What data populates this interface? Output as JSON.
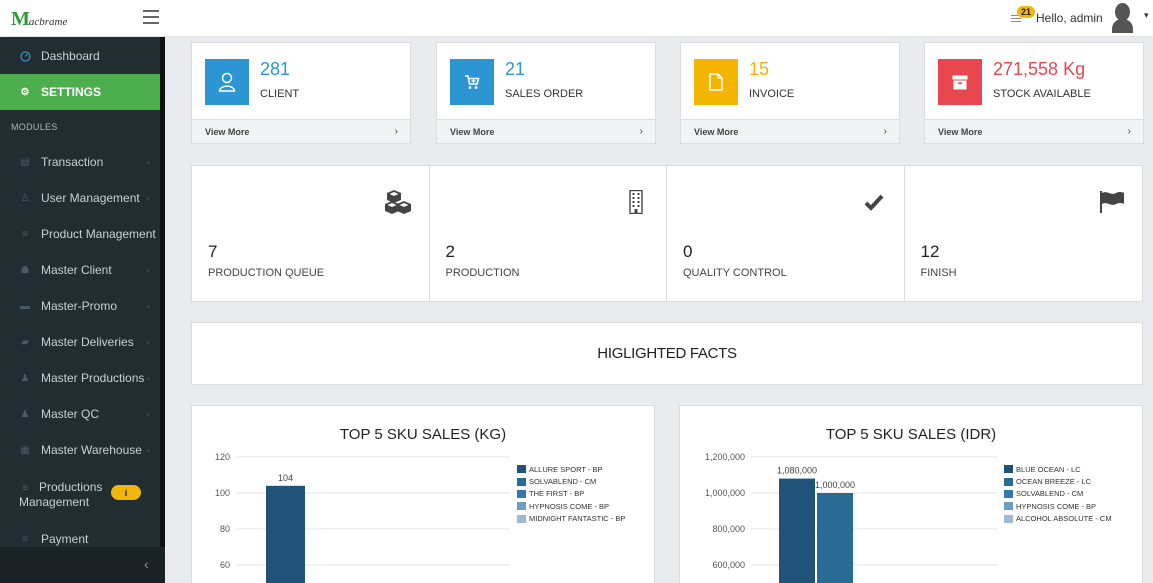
{
  "topbar": {
    "logo_mark": "M",
    "logo_text": "acbrame",
    "notification_count": "21",
    "greeting": "Hello, admin",
    "caret": "▾"
  },
  "sidebar": {
    "dashboard": "Dashboard",
    "settings": "SETTINGS",
    "modules_heading": "MODULES",
    "items": [
      {
        "label": "Transaction",
        "icon": "list-icon"
      },
      {
        "label": "User Management",
        "icon": "user-icon"
      },
      {
        "label": "Product Management",
        "icon": "bars-icon"
      },
      {
        "label": "Master Client",
        "icon": "users-icon"
      },
      {
        "label": "Master-Promo",
        "icon": "card-icon"
      },
      {
        "label": "Master Deliveries",
        "icon": "truck-icon"
      },
      {
        "label": "Master Productions",
        "icon": "person-icon"
      },
      {
        "label": "Master QC",
        "icon": "person-icon"
      },
      {
        "label": "Master Warehouse",
        "icon": "table-icon"
      }
    ],
    "productions_management": [
      "Productions",
      "Management"
    ],
    "productions_badge": "i",
    "payment": "Payment",
    "collapse": "‹"
  },
  "info_boxes": [
    {
      "value": "281",
      "label": "CLIENT",
      "more": "View More",
      "color": "#2b96d3",
      "value_color": "#2b96d3",
      "icon": "user-icon"
    },
    {
      "value": "21",
      "label": "SALES ORDER",
      "more": "View More",
      "color": "#2b96d3",
      "value_color": "#2b96d3",
      "icon": "cart-icon"
    },
    {
      "value": "15",
      "label": "INVOICE",
      "more": "View More",
      "color": "#f5b400",
      "value_color": "#f5b400",
      "icon": "file-icon"
    },
    {
      "value": "271,558 Kg",
      "label": "STOCK AVAILABLE",
      "more": "View More",
      "color": "#e8474d",
      "value_color": "#e8474d",
      "icon": "archive-icon"
    }
  ],
  "view_more_arrow": "›",
  "production": [
    {
      "value": "7",
      "label": "PRODUCTION QUEUE",
      "icon": "cubes-icon"
    },
    {
      "value": "2",
      "label": "PRODUCTION",
      "icon": "building-icon"
    },
    {
      "value": "0",
      "label": "QUALITY CONTROL",
      "icon": "check-icon"
    },
    {
      "value": "12",
      "label": "FINISH",
      "icon": "flag-icon"
    }
  ],
  "facts_title": "HIGLIGHTED FACTS",
  "chart_data": [
    {
      "type": "bar",
      "title": "TOP 5 SKU SALES (KG)",
      "series": [
        {
          "name": "ALLURE SPORT - BP",
          "values": [
            104
          ],
          "color": "#215379"
        },
        {
          "name": "SOLVABLEND - CM",
          "values": [
            null
          ],
          "color": "#2b6a95"
        },
        {
          "name": "THE FIRST - BP",
          "values": [
            null
          ],
          "color": "#3379ad"
        },
        {
          "name": "HYPNOSIS COME - BP",
          "values": [
            null
          ],
          "color": "#6e9dc4"
        },
        {
          "name": "MIDNIGHT FANTASTIC - BP",
          "values": [
            null
          ],
          "color": "#9db9d6"
        }
      ],
      "data_labels": [
        "104"
      ],
      "yticks": [
        "120",
        "100",
        "80",
        "60"
      ],
      "ylim": [
        60,
        120
      ],
      "legend": "right"
    },
    {
      "type": "bar",
      "title": "TOP 5 SKU SALES (IDR)",
      "series": [
        {
          "name": "BLUE OCEAN - LC",
          "values": [
            1080000
          ],
          "color": "#215379"
        },
        {
          "name": "OCEAN BREEZE - LC",
          "values": [
            1000000
          ],
          "color": "#2b6a95"
        },
        {
          "name": "SOLVABLEND - CM",
          "values": [
            null
          ],
          "color": "#3379ad"
        },
        {
          "name": "HYPNOSIS COME - BP",
          "values": [
            null
          ],
          "color": "#6e9dc4"
        },
        {
          "name": "ALCOHOL ABSOLUTE - CM",
          "values": [
            null
          ],
          "color": "#9db9d6"
        }
      ],
      "data_labels": [
        "1,080,000",
        "1,000,000"
      ],
      "yticks": [
        "1,200,000",
        "1,000,000",
        "800,000",
        "600,000"
      ],
      "ylim": [
        600000,
        1200000
      ],
      "legend": "right"
    }
  ]
}
